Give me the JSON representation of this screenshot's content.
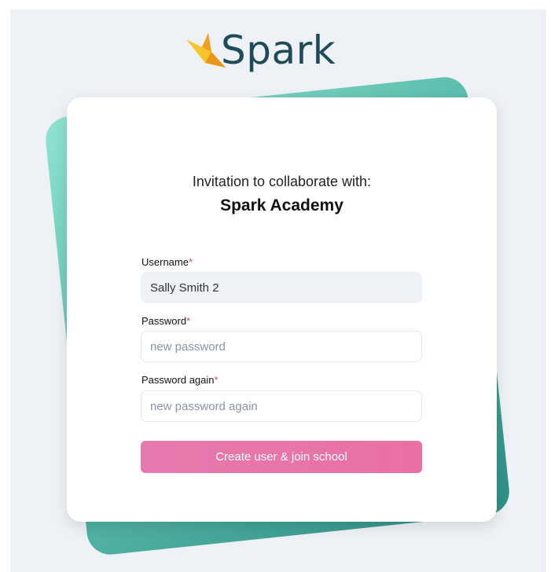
{
  "brand": {
    "name": "Spark",
    "logo_icon": "spark-star-icon",
    "logo_colors": [
      "#f7c52b",
      "#f0a020"
    ],
    "text_color": "#1f4a5a"
  },
  "invite": {
    "line": "Invitation to collaborate with:",
    "school": "Spark Academy"
  },
  "form": {
    "username": {
      "label": "Username",
      "required_marker": "*",
      "value": "Sally Smith 2"
    },
    "password": {
      "label": "Password",
      "required_marker": "*",
      "placeholder": "new password"
    },
    "password_again": {
      "label": "Password again",
      "required_marker": "*",
      "placeholder": "new password again"
    },
    "submit_label": "Create user & join school"
  },
  "colors": {
    "accent": "#ea6fa4",
    "required": "#e23c6b",
    "teal": "#5fbfae"
  }
}
